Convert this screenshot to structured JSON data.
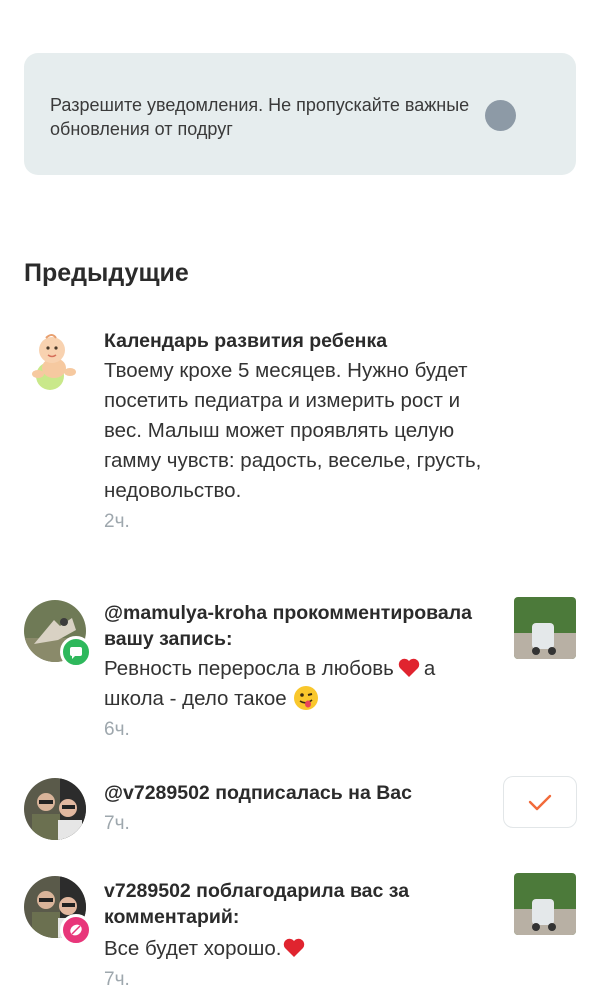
{
  "banner": {
    "text": "Разрешите уведомления. Не пропускайте важные обновления от подруг"
  },
  "section": {
    "title": "Предыдущие"
  },
  "notifications": [
    {
      "title": "Календарь развития ребенка",
      "text": "Твоему крохе 5 месяцев. Нужно будет посетить педиатра и измерить рост и вес. Малыш может проявлять целую гамму чувств: радость, веселье, грусть, недовольство.",
      "time": "2ч."
    },
    {
      "title": "@mamulya-kroha прокомментировала вашу запись:",
      "text_part1": "Ревность переросла в любовь",
      "text_part2": "а школа - дело такое",
      "time": "6ч."
    },
    {
      "title": "@v7289502 подписалась на Вас",
      "time": "7ч."
    },
    {
      "title": "v7289502 поблагодарила вас за комментарий:",
      "text": "Все будет хорошо.",
      "time": "7ч."
    }
  ],
  "colors": {
    "accent": "#f26a3a",
    "badge_comment": "#2eb85c",
    "badge_thanks": "#e8367a",
    "muted": "#9ea7ad",
    "banner_bg": "#e6edee"
  }
}
